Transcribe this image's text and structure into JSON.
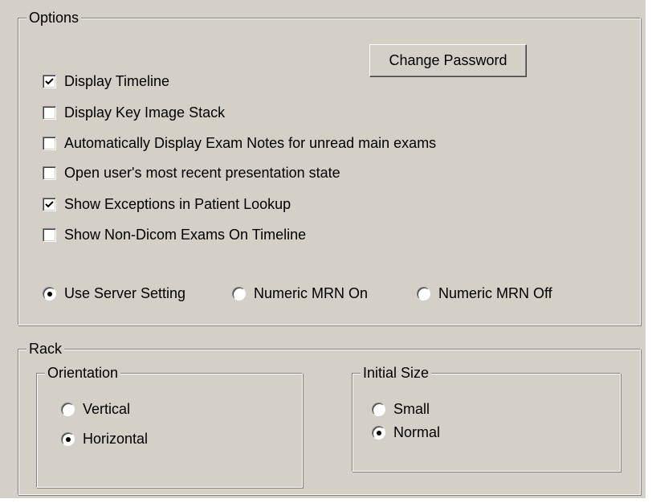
{
  "options": {
    "title": "Options",
    "change_password_label": "Change Password",
    "checkboxes": [
      {
        "label": "Display Timeline",
        "checked": true
      },
      {
        "label": "Display Key Image Stack",
        "checked": false
      },
      {
        "label": "Automatically Display Exam Notes for unread main exams",
        "checked": false
      },
      {
        "label": "Open user's most recent presentation state",
        "checked": false
      },
      {
        "label": "Show Exceptions in Patient Lookup",
        "checked": true
      },
      {
        "label": "Show Non-Dicom Exams On Timeline",
        "checked": false
      }
    ],
    "mrn_radios": [
      {
        "label": "Use Server Setting",
        "selected": true
      },
      {
        "label": "Numeric MRN On",
        "selected": false
      },
      {
        "label": "Numeric MRN Off",
        "selected": false
      }
    ]
  },
  "rack": {
    "title": "Rack",
    "orientation": {
      "title": "Orientation",
      "radios": [
        {
          "label": "Vertical",
          "selected": false
        },
        {
          "label": "Horizontal",
          "selected": true
        }
      ]
    },
    "initial_size": {
      "title": "Initial Size",
      "radios": [
        {
          "label": "Small",
          "selected": false
        },
        {
          "label": "Normal",
          "selected": true
        }
      ]
    }
  }
}
